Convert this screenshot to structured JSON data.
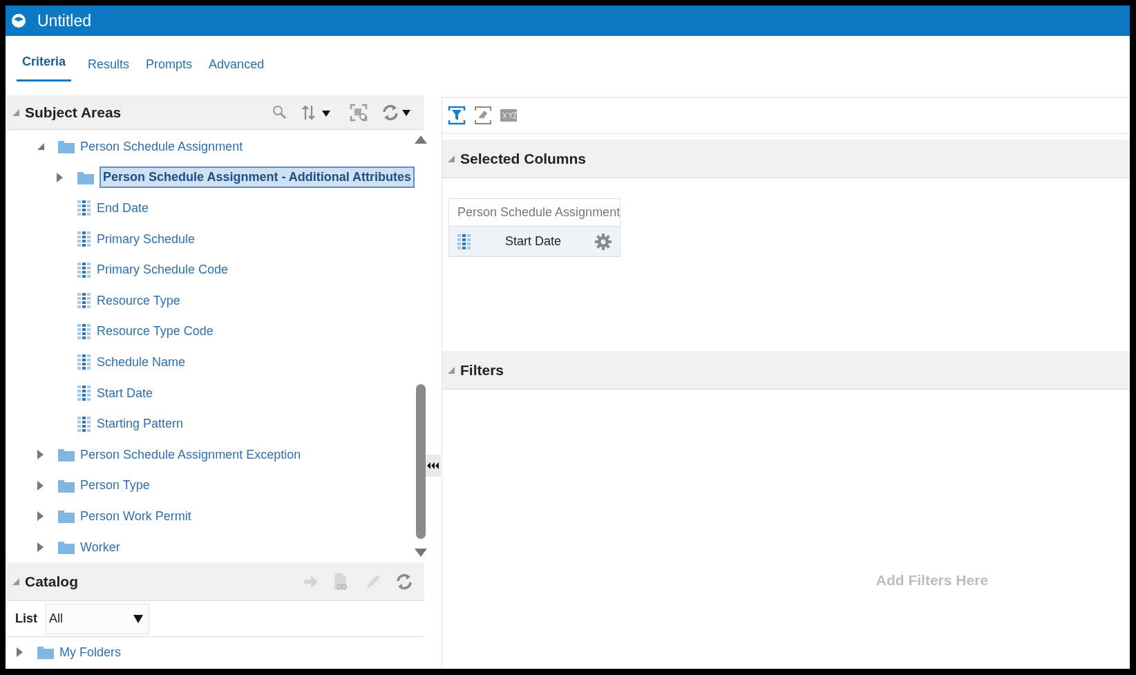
{
  "window": {
    "title": "Untitled"
  },
  "tabs": [
    {
      "label": "Criteria",
      "selected": true
    },
    {
      "label": "Results",
      "selected": false
    },
    {
      "label": "Prompts",
      "selected": false
    },
    {
      "label": "Advanced",
      "selected": false
    }
  ],
  "subject_areas": {
    "title": "Subject Areas",
    "expanded": true,
    "tree": [
      {
        "kind": "folder",
        "label": "Person Schedule Assignment",
        "expanded": true,
        "selected": false,
        "children": [
          {
            "kind": "folder",
            "label": "Person Schedule Assignment - Additional Attributes",
            "expanded": false,
            "selected": true
          },
          {
            "kind": "column",
            "label": "End Date",
            "selected": false
          },
          {
            "kind": "column",
            "label": "Primary Schedule",
            "selected": false
          },
          {
            "kind": "column",
            "label": "Primary Schedule Code",
            "selected": false
          },
          {
            "kind": "column",
            "label": "Resource Type",
            "selected": false
          },
          {
            "kind": "column",
            "label": "Resource Type Code",
            "selected": false
          },
          {
            "kind": "column",
            "label": "Schedule Name",
            "selected": false
          },
          {
            "kind": "column",
            "label": "Start Date",
            "selected": false
          },
          {
            "kind": "column",
            "label": "Starting Pattern",
            "selected": false
          }
        ]
      },
      {
        "kind": "folder",
        "label": "Person Schedule Assignment Exception",
        "expanded": false,
        "selected": false
      },
      {
        "kind": "folder",
        "label": "Person Type",
        "expanded": false,
        "selected": false
      },
      {
        "kind": "folder",
        "label": "Person Work Permit",
        "expanded": false,
        "selected": false
      },
      {
        "kind": "folder",
        "label": "Worker",
        "expanded": false,
        "selected": false
      }
    ]
  },
  "catalog": {
    "title": "Catalog",
    "expanded": true,
    "list_label": "List",
    "list_value": "All",
    "tree": [
      {
        "kind": "folder",
        "label": "My Folders",
        "expanded": false,
        "selected": false
      }
    ]
  },
  "selected_columns": {
    "title": "Selected Columns",
    "expanded": true,
    "groups": [
      {
        "title": "Person Schedule Assignment",
        "columns": [
          "Start Date"
        ]
      }
    ]
  },
  "filters": {
    "title": "Filters",
    "expanded": true,
    "hint": "Add Filters Here"
  }
}
